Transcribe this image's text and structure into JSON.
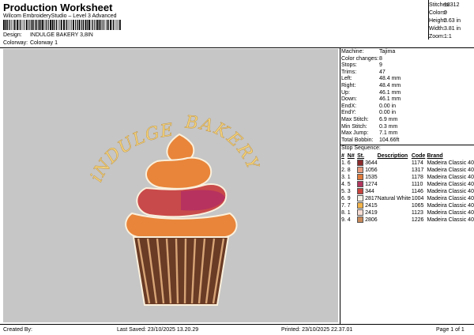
{
  "header": {
    "title": "Production Worksheet",
    "subtitle": "Wilcom EmbroideryStudio – Level 3 Advanced",
    "design_label": "Design:",
    "design_value": "INDULGE BAKERY 3,8IN",
    "colorway_label": "Colorway:",
    "colorway_value": "Colorway 1"
  },
  "stats": [
    {
      "k": "Stitches:",
      "v": "18312"
    },
    {
      "k": "Colors:",
      "v": "9"
    },
    {
      "k": "Height:",
      "v": "3.63 in"
    },
    {
      "k": "Width:",
      "v": "3.81 in"
    },
    {
      "k": "Zoom:",
      "v": "1:1"
    }
  ],
  "artwork": {
    "text_left": "iNDULGE",
    "text_right": "BAKERY",
    "colors": {
      "cream": "#f3d27a",
      "orange": "#e8853a",
      "red": "#c94a4a",
      "magenta": "#b7325f",
      "brown": "#6a3b25",
      "outline": "#fbf0dc"
    }
  },
  "machine": [
    {
      "k": "Machine:",
      "v": "Tajima"
    },
    {
      "k": "Color changes:",
      "v": "8"
    },
    {
      "k": "Stops:",
      "v": "9"
    },
    {
      "k": "Trims:",
      "v": "47"
    },
    {
      "k": "Left:",
      "v": "48.4 mm"
    },
    {
      "k": "Right:",
      "v": "48.4 mm"
    },
    {
      "k": "Up:",
      "v": "46.1 mm"
    },
    {
      "k": "Down:",
      "v": "46.1 mm"
    },
    {
      "k": "EndX:",
      "v": "0.00 in"
    },
    {
      "k": "EndY:",
      "v": "0.00 in"
    },
    {
      "k": "Max Stitch:",
      "v": "6.9 mm"
    },
    {
      "k": "Min Stitch:",
      "v": "0.3 mm"
    },
    {
      "k": "Max Jump:",
      "v": "7.1 mm"
    },
    {
      "k": "Total Bobbin:",
      "v": "104.66ft"
    }
  ],
  "stop_sequence": {
    "title": "Stop Sequence:",
    "headers": [
      "#",
      "N#",
      "St.",
      "Description",
      "Code",
      "Brand"
    ],
    "rows": [
      {
        "num": "1.",
        "n": "6",
        "color": "#8b2b2b",
        "code": "3644",
        "desc": "",
        "st": "1174",
        "brand": "Madeira Classic 40"
      },
      {
        "num": "2.",
        "n": "8",
        "color": "#e79a7c",
        "code": "1056",
        "desc": "",
        "st": "1317",
        "brand": "Madeira Classic 40"
      },
      {
        "num": "3.",
        "n": "1",
        "color": "#e07a3a",
        "code": "1535",
        "desc": "",
        "st": "1178",
        "brand": "Madeira Classic 40"
      },
      {
        "num": "4.",
        "n": "5",
        "color": "#b0365e",
        "code": "1274",
        "desc": "",
        "st": "1110",
        "brand": "Madeira Classic 40"
      },
      {
        "num": "5.",
        "n": "3",
        "color": "#c8443c",
        "code": "344",
        "desc": "",
        "st": "1146",
        "brand": "Madeira Classic 40"
      },
      {
        "num": "6.",
        "n": "9",
        "color": "#f6f1e6",
        "code": "2817",
        "desc": "Natural White",
        "st": "1004",
        "brand": "Madeira Classic 40"
      },
      {
        "num": "7.",
        "n": "7",
        "color": "#f1b34a",
        "code": "2415",
        "desc": "",
        "st": "1065",
        "brand": "Madeira Classic 40"
      },
      {
        "num": "8.",
        "n": "1",
        "color": "#f7ddd4",
        "code": "2419",
        "desc": "",
        "st": "1123",
        "brand": "Madeira Classic 40"
      },
      {
        "num": "9.",
        "n": "4",
        "color": "#c98a5a",
        "code": "2806",
        "desc": "",
        "st": "1226",
        "brand": "Madeira Classic 40"
      }
    ]
  },
  "footer": {
    "created": "Created By:",
    "saved": "Last Saved: 23/10/2025 13.20.29",
    "printed": "Printed: 23/10/2025 22.37.01",
    "page": "Page 1 of 1"
  }
}
